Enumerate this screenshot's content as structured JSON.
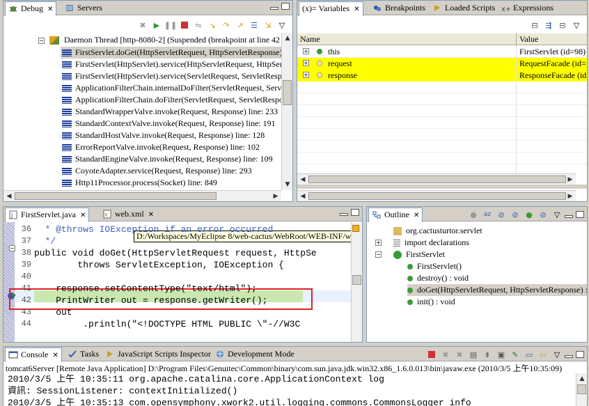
{
  "debug": {
    "tabs": [
      {
        "label": "Debug",
        "close": "✕"
      },
      {
        "label": "Servers"
      }
    ],
    "thread": "Daemon Thread [http-8080-2] (Suspended (breakpoint at line 42 in",
    "frames": [
      "FirstServlet.doGet(HttpServletRequest, HttpServletResponse) lin",
      "FirstServlet(HttpServlet).service(HttpServletRequest, HttpServle",
      "FirstServlet(HttpServlet).service(ServletRequest, ServletRespons",
      "ApplicationFilterChain.internalDoFilter(ServletRequest, Servlet",
      "ApplicationFilterChain.doFilter(ServletRequest, ServletRespons",
      "StandardWrapperValve.invoke(Request, Response) line: 233",
      "StandardContextValve.invoke(Request, Response) line: 191",
      "StandardHostValve.invoke(Request, Response) line: 128",
      "ErrorReportValve.invoke(Request, Response) line: 102",
      "StandardEngineValve.invoke(Request, Response) line: 109",
      "CoyoteAdapter.service(Request, Response) line: 293",
      "Http11Processor.process(Socket) line: 849"
    ]
  },
  "variables": {
    "tabs": [
      {
        "label": "(x)= Variables",
        "close": "✕"
      },
      {
        "label": "Breakpoints"
      },
      {
        "label": "Loaded Scripts"
      },
      {
        "label": "Expressions"
      }
    ],
    "col_name": "Name",
    "col_value": "Value",
    "rows": [
      {
        "name": "this",
        "value": "FirstServlet  (id=98)"
      },
      {
        "name": "request",
        "value": "RequestFacade  (id="
      },
      {
        "name": "response",
        "value": "ResponseFacade  (id"
      }
    ]
  },
  "editor": {
    "tabs": [
      {
        "label": "FirstServlet.java",
        "close": "✕"
      },
      {
        "label": "web.xml",
        "close": "✕"
      }
    ],
    "tooltip": "D:/Workspaces/MyEclipse 8/web-cactus/WebRoot/WEB-INF/web.xml",
    "lines": [
      {
        "num": "36",
        "text": "  * @throws IOException if an error occurred"
      },
      {
        "num": "37",
        "text": "  */"
      },
      {
        "num": "38",
        "text": "public void doGet(HttpServletRequest request, HttpSe"
      },
      {
        "num": "39",
        "text": "        throws ServletException, IOException {"
      },
      {
        "num": "40",
        "text": ""
      },
      {
        "num": "41",
        "text": "    response.setContentType(\"text/html\");"
      },
      {
        "num": "42",
        "text": "    PrintWriter out = response.getWriter();"
      },
      {
        "num": "43",
        "text": "    out"
      },
      {
        "num": "44",
        "text": "         .println(\"<!DOCTYPE HTML PUBLIC \\\"-//W3C"
      }
    ]
  },
  "outline": {
    "tabs": [
      {
        "label": "Outline",
        "close": "✕"
      }
    ],
    "items": [
      {
        "label": "org.cactusturtor.servlet"
      },
      {
        "label": "import declarations"
      },
      {
        "label": "FirstServlet"
      },
      {
        "label": "FirstServlet()"
      },
      {
        "label": "destroy() : void"
      },
      {
        "label": "doGet(HttpServletRequest, HttpServletResponse) :"
      },
      {
        "label": "init() : void"
      }
    ]
  },
  "console": {
    "tabs": [
      {
        "label": "Console",
        "close": "✕"
      },
      {
        "label": "Tasks"
      },
      {
        "label": "JavaScript Scripts Inspector"
      },
      {
        "label": "Development Mode"
      }
    ],
    "header": "tomcat6Server [Remote Java Application] D:\\Program Files\\Genuitec\\Common\\binary\\com.sun.java.jdk.win32.x86_1.6.0.013\\bin\\javaw.exe (2010/3/5 上午10:35:09)",
    "lines": [
      "2010/3/5 上午 10:35:11 org.apache.catalina.core.ApplicationContext log",
      "資訊: SessionListener: contextInitialized()",
      "2010/3/5 上午 10:35:13 com.opensymphony.xwork2.util.logging.commons.CommonsLogger info"
    ]
  },
  "colors": {
    "highlight_yellow": "#ffff00",
    "current_line": "#c8e8b0",
    "selection": "#d4d0c8",
    "breakpoint_box": "#e02020"
  }
}
